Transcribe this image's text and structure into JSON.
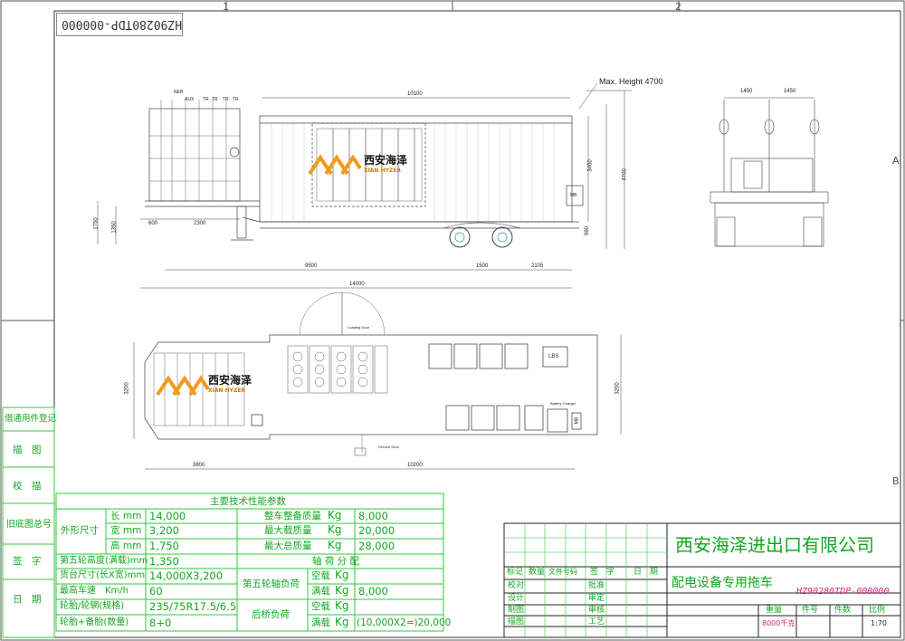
{
  "drawing_number_rotated": "HZ90280TDP-000000",
  "zone_marks": {
    "top": [
      "1",
      "2"
    ],
    "side": [
      "A",
      "B"
    ]
  },
  "side_view": {
    "dims": [
      "10100",
      "3400",
      "4700",
      "1750",
      "1350",
      "600",
      "2300",
      "960",
      "9500",
      "1500",
      "2105",
      "14000"
    ],
    "max_height_note": "Max. Height 4700",
    "labels": [
      "NER",
      "AUX",
      "TR",
      "TR",
      "TR",
      "TR",
      "MB"
    ],
    "logo_cn": "西安海泽",
    "logo_en": "XIAN HYZER"
  },
  "rear_view": {
    "dims": [
      "1450",
      "1450"
    ]
  },
  "plan_view": {
    "dims": [
      "3200",
      "3800",
      "10200",
      "3200"
    ],
    "labels": [
      "Loading Door",
      "Service Door",
      "LBS",
      "MB",
      "Battery Charger"
    ],
    "logo_cn": "西安海泽",
    "logo_en": "XIAN HYZER"
  },
  "left_strip": [
    "借通用件登记",
    "描　图",
    "校　描",
    "旧底图总号",
    "签　字",
    "日　期"
  ],
  "params": {
    "title": "主要技术性能参数",
    "group1_label": "外形尺寸",
    "group1_rows": [
      {
        "k": "长 mm",
        "v": "14,000"
      },
      {
        "k": "宽 mm",
        "v": "3,200"
      },
      {
        "k": "高 mm",
        "v": "1,750"
      }
    ],
    "left_rows": [
      {
        "k": "第五轮高度(满载)mm",
        "v": "1,350"
      },
      {
        "k": "货台尺寸(长X宽)mm",
        "v": "14,000X3,200"
      },
      {
        "k": "最高车速　Km/h",
        "v": "60"
      },
      {
        "k": "轮胎/轮辋(规格)",
        "v": "235/75R17.5/6.5"
      },
      {
        "k": "轮胎+备胎(数量)",
        "v": "8+0"
      }
    ],
    "right_top": [
      {
        "k": "整车整备质量",
        "u": "Kg",
        "v": "8,000"
      },
      {
        "k": "最大载质量",
        "u": "Kg",
        "v": "20,000"
      },
      {
        "k": "最大总质量",
        "u": "Kg",
        "v": "28,000"
      }
    ],
    "axle_title": "轴 荷 分 配",
    "fifth_wheel": "第五轮轴负荷",
    "rear_axle": "后桥负荷",
    "axle_rows": [
      {
        "k": "空载",
        "u": "Kg",
        "v": ""
      },
      {
        "k": "满载",
        "u": "Kg",
        "v": "8,000"
      },
      {
        "k": "空载",
        "u": "Kg",
        "v": ""
      },
      {
        "k": "满载",
        "u": "Kg",
        "v": "(10,000X2=)20,000"
      }
    ]
  },
  "title_block": {
    "company": "西安海泽进出口有限公司",
    "product": "配电设备专用拖车",
    "drawing_no": "HZ90280TDP-000000",
    "header_cells": [
      "标记",
      "数量",
      "文件号码",
      "签　字",
      "日　期"
    ],
    "sign_rows": [
      "校对",
      "设计",
      "制图",
      "描图"
    ],
    "approval_rows": [
      "批准",
      "审定",
      "审核",
      "工艺"
    ],
    "weight_label": "重量",
    "pieces_label": "件号",
    "count_label": "件数",
    "scale_label": "比例",
    "weight_value": "8000千克",
    "scale_value": "1:70"
  }
}
